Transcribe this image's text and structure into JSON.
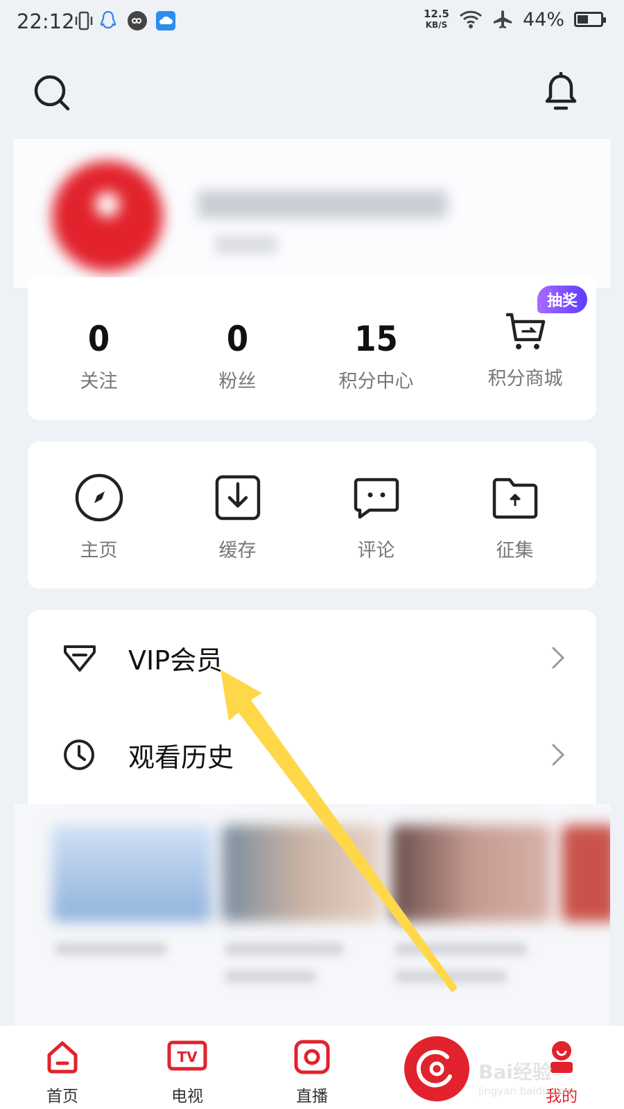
{
  "status_bar": {
    "time": "22:12",
    "net_speed_value": "12.5",
    "net_speed_unit": "KB/S",
    "battery": "44%",
    "icons": [
      "vibrate-icon",
      "qq-icon",
      "link-icon",
      "cloud-icon",
      "wifi-icon",
      "airplane-icon",
      "battery-icon"
    ]
  },
  "header": {
    "left_icon": "search-icon",
    "right_icon": "bell-icon"
  },
  "stats": [
    {
      "value": "0",
      "label": "关注"
    },
    {
      "value": "0",
      "label": "粉丝"
    },
    {
      "value": "15",
      "label": "积分中心"
    }
  ],
  "shop": {
    "label": "积分商城",
    "badge": "抽奖"
  },
  "tools": [
    {
      "label": "主页",
      "icon": "compass-icon"
    },
    {
      "label": "缓存",
      "icon": "download-icon"
    },
    {
      "label": "评论",
      "icon": "comment-icon"
    },
    {
      "label": "征集",
      "icon": "folder-upload-icon"
    }
  ],
  "menu": [
    {
      "label": "VIP会员",
      "icon": "diamond-icon"
    },
    {
      "label": "观看历史",
      "icon": "clock-icon"
    }
  ],
  "tabbar": [
    {
      "label": "首页",
      "icon": "home-icon"
    },
    {
      "label": "电视",
      "icon": "tv-icon"
    },
    {
      "label": "直播",
      "icon": "live-icon"
    },
    {
      "label": "我的",
      "icon": "profile-icon",
      "active": true
    }
  ],
  "watermark": {
    "line1": "Bai经验",
    "line2": "jingyan.baidu.com"
  },
  "colors": {
    "accent": "#e2222c",
    "arrow": "#ffd84a",
    "badge": "#7a4dff"
  }
}
